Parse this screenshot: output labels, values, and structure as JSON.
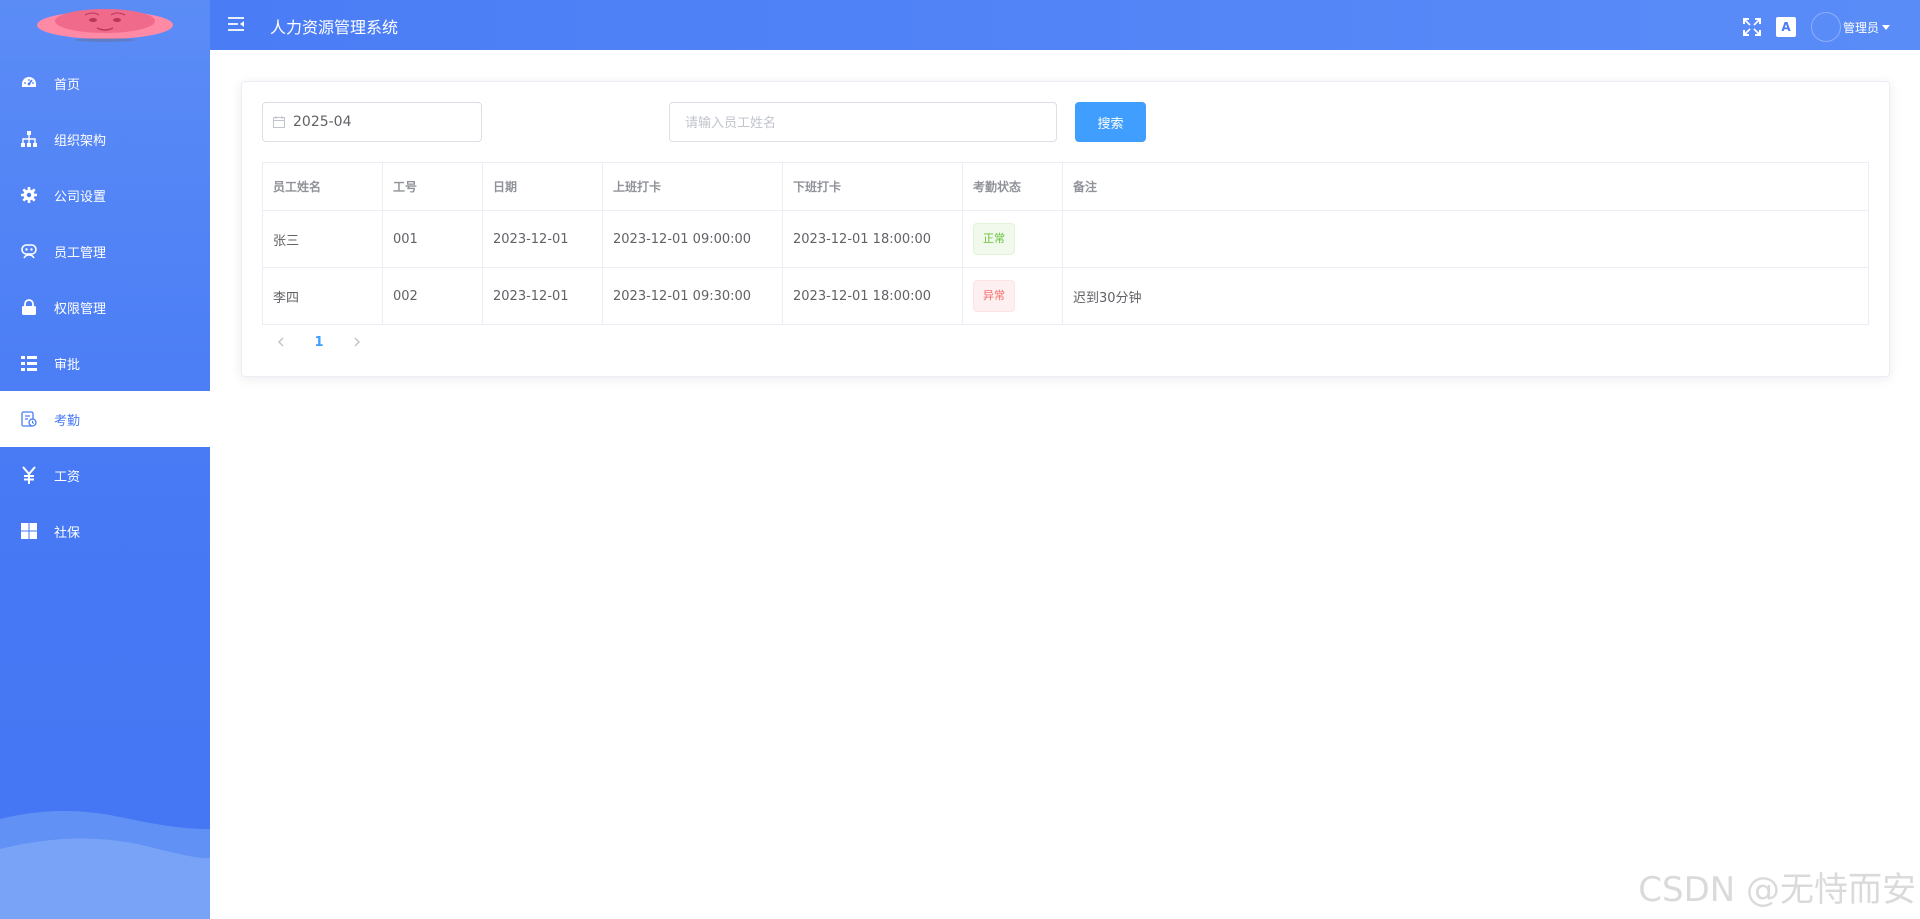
{
  "header": {
    "title": "人力资源管理系统",
    "user_name": "管理员",
    "lang_label": "A"
  },
  "sidebar": {
    "items": [
      {
        "label": "首页",
        "icon": "dashboard-icon"
      },
      {
        "label": "组织架构",
        "icon": "org-tree-icon"
      },
      {
        "label": "公司设置",
        "icon": "gear-icon"
      },
      {
        "label": "员工管理",
        "icon": "employee-icon"
      },
      {
        "label": "权限管理",
        "icon": "lock-icon"
      },
      {
        "label": "审批",
        "icon": "approval-list-icon"
      },
      {
        "label": "考勤",
        "icon": "attendance-icon",
        "active": true
      },
      {
        "label": "工资",
        "icon": "yen-icon"
      },
      {
        "label": "社保",
        "icon": "grid-icon"
      }
    ]
  },
  "filters": {
    "month": "2025-04",
    "search_placeholder": "请输入员工姓名",
    "search_button": "搜索"
  },
  "table": {
    "headers": [
      "员工姓名",
      "工号",
      "日期",
      "上班打卡",
      "下班打卡",
      "考勤状态",
      "备注"
    ],
    "rows": [
      {
        "name": "张三",
        "id": "001",
        "date": "2023-12-01",
        "checkin": "2023-12-01 09:00:00",
        "checkout": "2023-12-01 18:00:00",
        "status": "正常",
        "note": ""
      },
      {
        "name": "李四",
        "id": "002",
        "date": "2023-12-01",
        "checkin": "2023-12-01 09:30:00",
        "checkout": "2023-12-01 18:00:00",
        "status": "异常",
        "note": "迟到30分钟"
      }
    ]
  },
  "pagination": {
    "current_page": "1"
  },
  "watermark": "CSDN @无恃而安",
  "colors": {
    "primary": "#409eff",
    "sidebar": "#4a7cf6",
    "normal": "#67c23a",
    "abnormal": "#f56c6c"
  }
}
